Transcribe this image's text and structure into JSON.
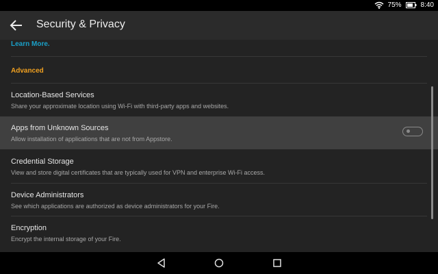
{
  "status": {
    "battery": "75%",
    "time": "8:40"
  },
  "header": {
    "title": "Security & Privacy"
  },
  "content": {
    "learn_more": "Learn More.",
    "section": "Advanced",
    "items": [
      {
        "title": "Location-Based Services",
        "subtitle": "Share your approximate location using Wi-Fi with third-party apps and websites."
      },
      {
        "title": "Apps from Unknown Sources",
        "subtitle": "Allow installation of applications that are not from Appstore.",
        "toggle": "off",
        "highlighted": true
      },
      {
        "title": "Credential Storage",
        "subtitle": "View and store digital certificates that are typically used for VPN and enterprise Wi-Fi access."
      },
      {
        "title": "Device Administrators",
        "subtitle": "See which applications are authorized as device administrators for your Fire."
      },
      {
        "title": "Encryption",
        "subtitle": "Encrypt the internal storage of your Fire."
      }
    ]
  },
  "nav": {
    "icons": [
      "back-triangle-icon",
      "home-circle-icon",
      "recents-square-icon"
    ]
  },
  "colors": {
    "accent_section": "#f0a020",
    "link": "#1aa0c8",
    "background": "#232323",
    "highlight": "#404040"
  }
}
